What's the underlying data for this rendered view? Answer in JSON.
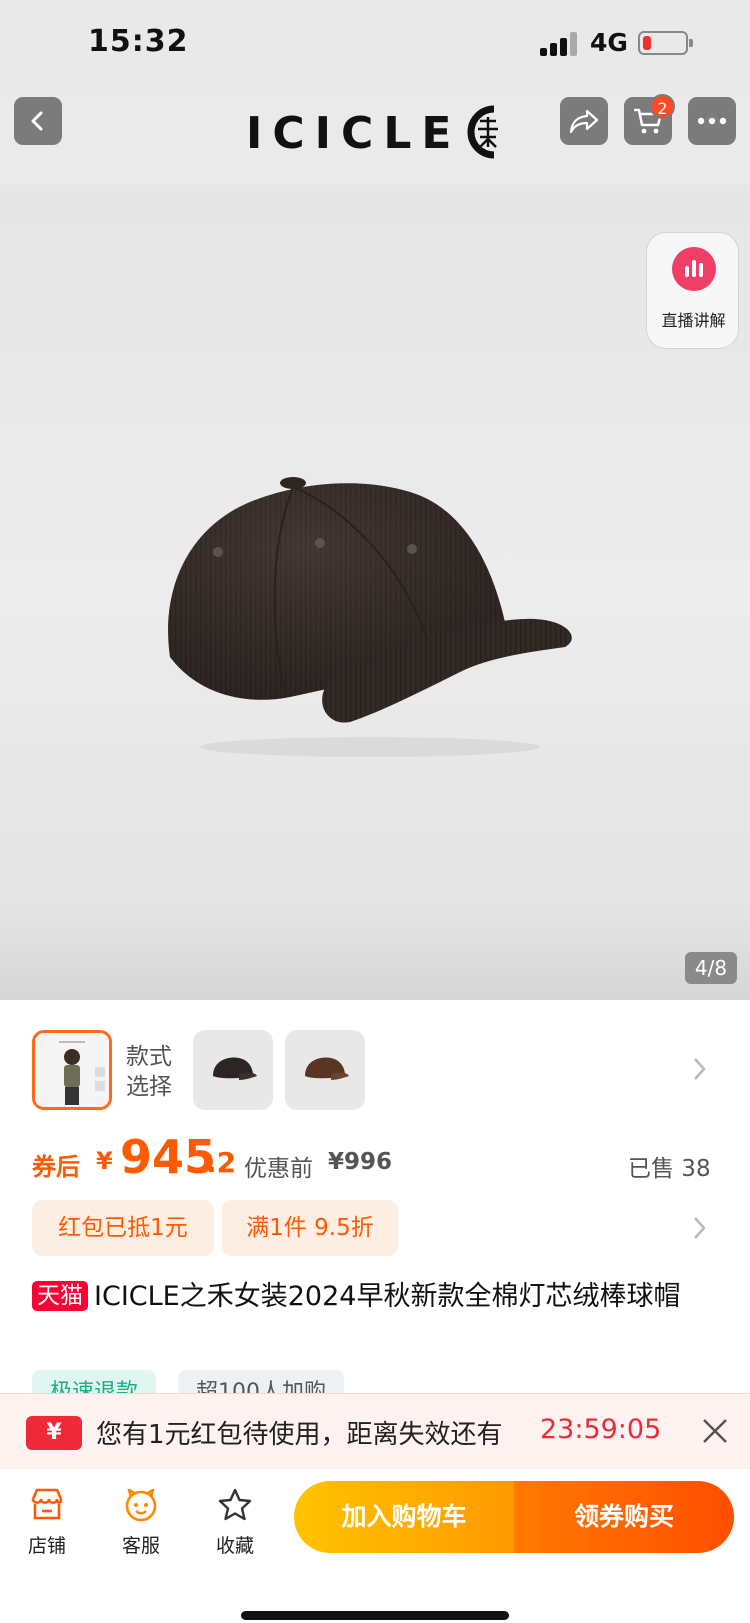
{
  "status_bar": {
    "time": "15:32",
    "network": "4G"
  },
  "header": {
    "logo": "ICICLE",
    "cart_badge": "2"
  },
  "gallery": {
    "live_label": "直播讲解",
    "counter": "4/8"
  },
  "style_select": {
    "label": "款式选择"
  },
  "price": {
    "coupon_label": "券后",
    "currency": "¥",
    "integer": "945",
    "decimal": ".2",
    "original_label": "优惠前",
    "original_price": "¥996",
    "sold": "已售 38"
  },
  "promos": [
    "红包已抵1元",
    "满1件 9.5折"
  ],
  "product": {
    "tag": "天猫",
    "title": "ICICLE之禾女装2024早秋新款全棉灯芯绒棒球帽"
  },
  "tags": [
    "极速退款",
    "超100人加购"
  ],
  "coupon_banner": {
    "icon": "¥",
    "text": "您有1元红包待使用，距离失效还有",
    "timer": "23:59:05"
  },
  "bottom_bar": {
    "shop": "店铺",
    "service": "客服",
    "favorite": "收藏",
    "add_to_cart": "加入购物车",
    "buy": "领券购买"
  },
  "colors": {
    "accent": "#ff5a00",
    "tmall": "#ff0036",
    "cta_yellow": "#ffb000",
    "cta_orange": "#ff5a00"
  }
}
